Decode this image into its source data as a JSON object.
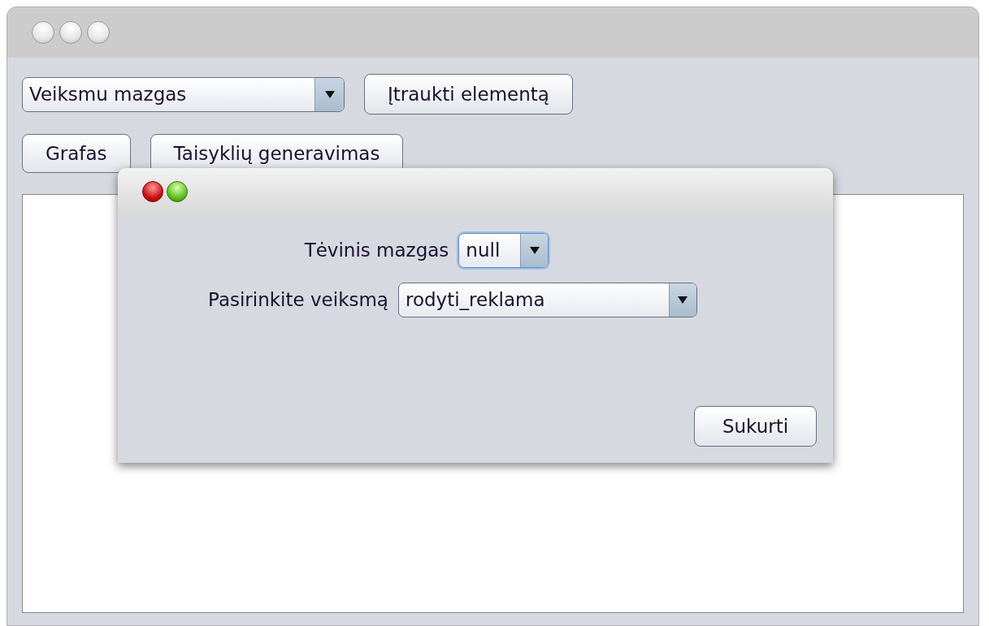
{
  "main_window": {
    "node_type_combo": {
      "value": "Veiksmu mazgas"
    },
    "add_button": {
      "label": "Įtraukti elementą"
    },
    "tabs": [
      {
        "label": "Grafas",
        "selected": false
      },
      {
        "label": "Taisyklių generavimas",
        "selected": false
      }
    ]
  },
  "dialog": {
    "fields": [
      {
        "label": "Tėvinis mazgas",
        "value": "null",
        "focused": true
      },
      {
        "label": "Pasirinkite veiksmą",
        "value": "rodyti_reklama",
        "focused": false
      }
    ],
    "create_button": {
      "label": "Sukurti"
    }
  }
}
